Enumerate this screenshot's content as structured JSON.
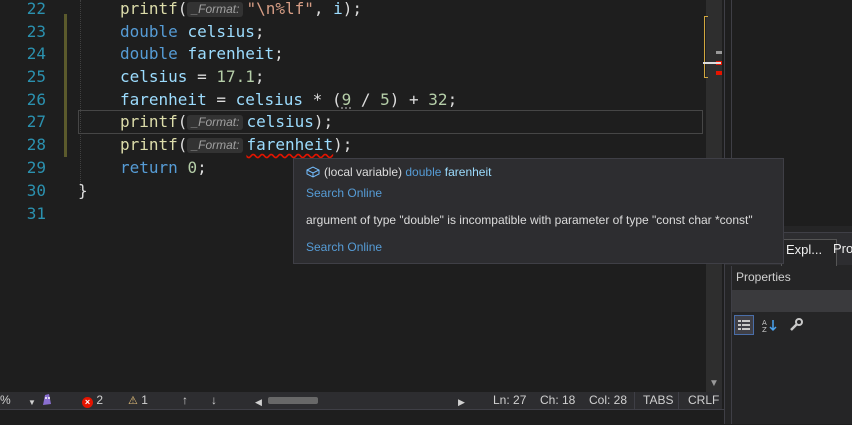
{
  "editor": {
    "line_numbers": [
      "22",
      "23",
      "24",
      "25",
      "26",
      "27",
      "28",
      "29",
      "30",
      "31"
    ],
    "inlay_hint": "_Format:",
    "lines": {
      "l22": {
        "fn": "printf",
        "open": "(",
        "str": "\"\\n%lf\"",
        "rest": ", ",
        "arg": "i",
        "close": ");"
      },
      "l23": {
        "type": "double",
        "name": "celsius",
        "end": ";"
      },
      "l24": {
        "type": "double",
        "name": "farenheit",
        "end": ";"
      },
      "l25": {
        "name": "celsius",
        "op": " = ",
        "num": "17.1",
        "end": ";"
      },
      "l26": {
        "name": "farenheit",
        "op": " = ",
        "var": "celsius",
        "op2": " * (",
        "n1": "9",
        "op3": " / ",
        "n2": "5",
        "op4": ") + ",
        "n3": "32",
        "end": ";"
      },
      "l27": {
        "fn": "printf",
        "open": "(",
        "arg": "celsius",
        "close": ");"
      },
      "l28": {
        "fn": "printf",
        "open": "(",
        "arg": "farenheit",
        "close": ");"
      },
      "l29": {
        "kw": "return",
        "num": "0",
        "end": ";"
      },
      "l30": {
        "brace": "}"
      }
    }
  },
  "tooltip": {
    "scope": "(local variable)",
    "type": "double",
    "name": "farenheit",
    "search1": "Search Online",
    "message": "argument of type \"double\" is incompatible with parameter of type \"const char *const\"",
    "search2": "Search Online"
  },
  "right_panel": {
    "tab1": "Expl...",
    "tab2": "Pro",
    "properties_title": "Properties"
  },
  "status_bar": {
    "zoom": "%",
    "errors": "2",
    "warnings": "1",
    "ln": "Ln: 27",
    "ch": "Ch: 18",
    "col": "Col: 28",
    "tabs": "TABS",
    "eol": "CRLF"
  },
  "icons": {
    "error": "error-circle-icon",
    "warning": "warning-triangle-icon",
    "variable": "variable-cube-icon"
  }
}
